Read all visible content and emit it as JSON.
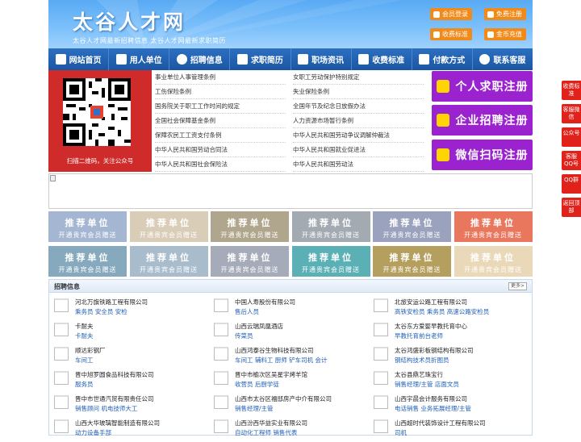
{
  "header": {
    "site_title": "太谷人才网",
    "slogan": "太谷人才网最新招聘信息    太谷人才网最新求职简历",
    "buttons": [
      {
        "label": "会员登录",
        "icon": "user-icon"
      },
      {
        "label": "免费注册",
        "icon": "register-icon"
      },
      {
        "label": "收费标准",
        "icon": "price-icon"
      },
      {
        "label": "金币充值",
        "icon": "coin-icon"
      }
    ]
  },
  "nav": {
    "items": [
      {
        "label": "网站首页",
        "icon": "home-icon"
      },
      {
        "label": "用人单位",
        "icon": "building-icon"
      },
      {
        "label": "招聘信息",
        "icon": "recruit-icon"
      },
      {
        "label": "求职简历",
        "icon": "resume-icon"
      },
      {
        "label": "职场资讯",
        "icon": "news-icon"
      },
      {
        "label": "收费标准",
        "icon": "price-icon"
      },
      {
        "label": "付款方式",
        "icon": "payment-icon"
      },
      {
        "label": "联系客服",
        "icon": "phone-icon"
      }
    ]
  },
  "qr": {
    "caption": "扫描二维码，关注公众号"
  },
  "policies": [
    "事业单位人事管理条例",
    "女职工劳动保护特别规定",
    "工伤保险条例",
    "失业保险条例",
    "国务院关于职工工作时间的规定",
    "全国年节及纪念日放假办法",
    "全国社会保障基金条例",
    "人力资源市场暂行条例",
    "保障农民工工资支付条例",
    "中华人民共和国劳动争议调解仲裁法",
    "中华人民共和国劳动合同法",
    "中华人民共和国就业促进法",
    "中华人民共和国社会保险法",
    "中华人民共和国劳动法"
  ],
  "register": [
    {
      "label": "个人求职注册",
      "icon": "person-icon"
    },
    {
      "label": "企业招聘注册",
      "icon": "company-icon"
    },
    {
      "label": "微信扫码注册",
      "icon": "wechat-icon"
    }
  ],
  "recommend": {
    "title": "推荐单位",
    "subtitle": "开通贵宾会员赠送",
    "colors": [
      "#a5b6d2",
      "#d9cdb8",
      "#b0a68d",
      "#a3aab1",
      "#9aa2bd",
      "#e9775e",
      "#86a9bd",
      "#a9bccb",
      "#a5abb8",
      "#5ab0b5",
      "#b59f5f",
      "#ead9b8"
    ]
  },
  "jobs": {
    "title": "招聘信息",
    "more": "更多>",
    "items": [
      {
        "company": "河北万旗铁路工程有限公司",
        "positions": "乘务员 安全员 安检"
      },
      {
        "company": "中国人寿股份有限公司",
        "positions": "售后人员"
      },
      {
        "company": "北旅安运公路工程有限公司",
        "positions": "高铁安检员 乘务员 高速公路安检员"
      },
      {
        "company": "卡耐夫",
        "positions": "卡耐夫"
      },
      {
        "company": "山西云瑞凤凰酒店",
        "positions": "传菜员"
      },
      {
        "company": "太谷东方爱婴早教托育中心",
        "positions": "早教托育前台老师"
      },
      {
        "company": "顺达彩钢厂",
        "positions": "车间工"
      },
      {
        "company": "山西鸿泰谷生物科技有限公司",
        "positions": "车间工 辅料工 厨师 铲车司机 会计"
      },
      {
        "company": "太谷鸿盛彩板钢结构有限公司",
        "positions": "钢结构技术员折图员"
      },
      {
        "company": "晋中旭罗圆食品科技有限公司",
        "positions": "服务员"
      },
      {
        "company": "晋中市榆次区吴星宇烤羊馆",
        "positions": "收营员 后厨学徒"
      },
      {
        "company": "太谷县鼎艺珠宝行",
        "positions": "销售经理/主管 店面文员"
      },
      {
        "company": "晋中市世通汽贸有限责任公司",
        "positions": "销售顾问 机电技师大工"
      },
      {
        "company": "山西市太谷区福邸房产中介有限公司",
        "positions": "销售经理/主管"
      },
      {
        "company": "山西宇晨会计服务有限公司",
        "positions": "电话销售 业务拓展经理/主管"
      },
      {
        "company": "山西大华玻璃智能制造有限公司",
        "positions": "动力设备手部"
      },
      {
        "company": "山西汾西华益实业有限公司",
        "positions": "自动化工程师 销售代表"
      },
      {
        "company": "山西超时代装饰设计工程有限公司",
        "positions": "司机"
      }
    ]
  },
  "sidebar": [
    {
      "label": "收费标准"
    },
    {
      "label": "客服微信"
    },
    {
      "label": "公众号"
    },
    {
      "label": "客服QQ号"
    },
    {
      "label": "QQ群"
    },
    {
      "label": "返回顶部"
    }
  ]
}
